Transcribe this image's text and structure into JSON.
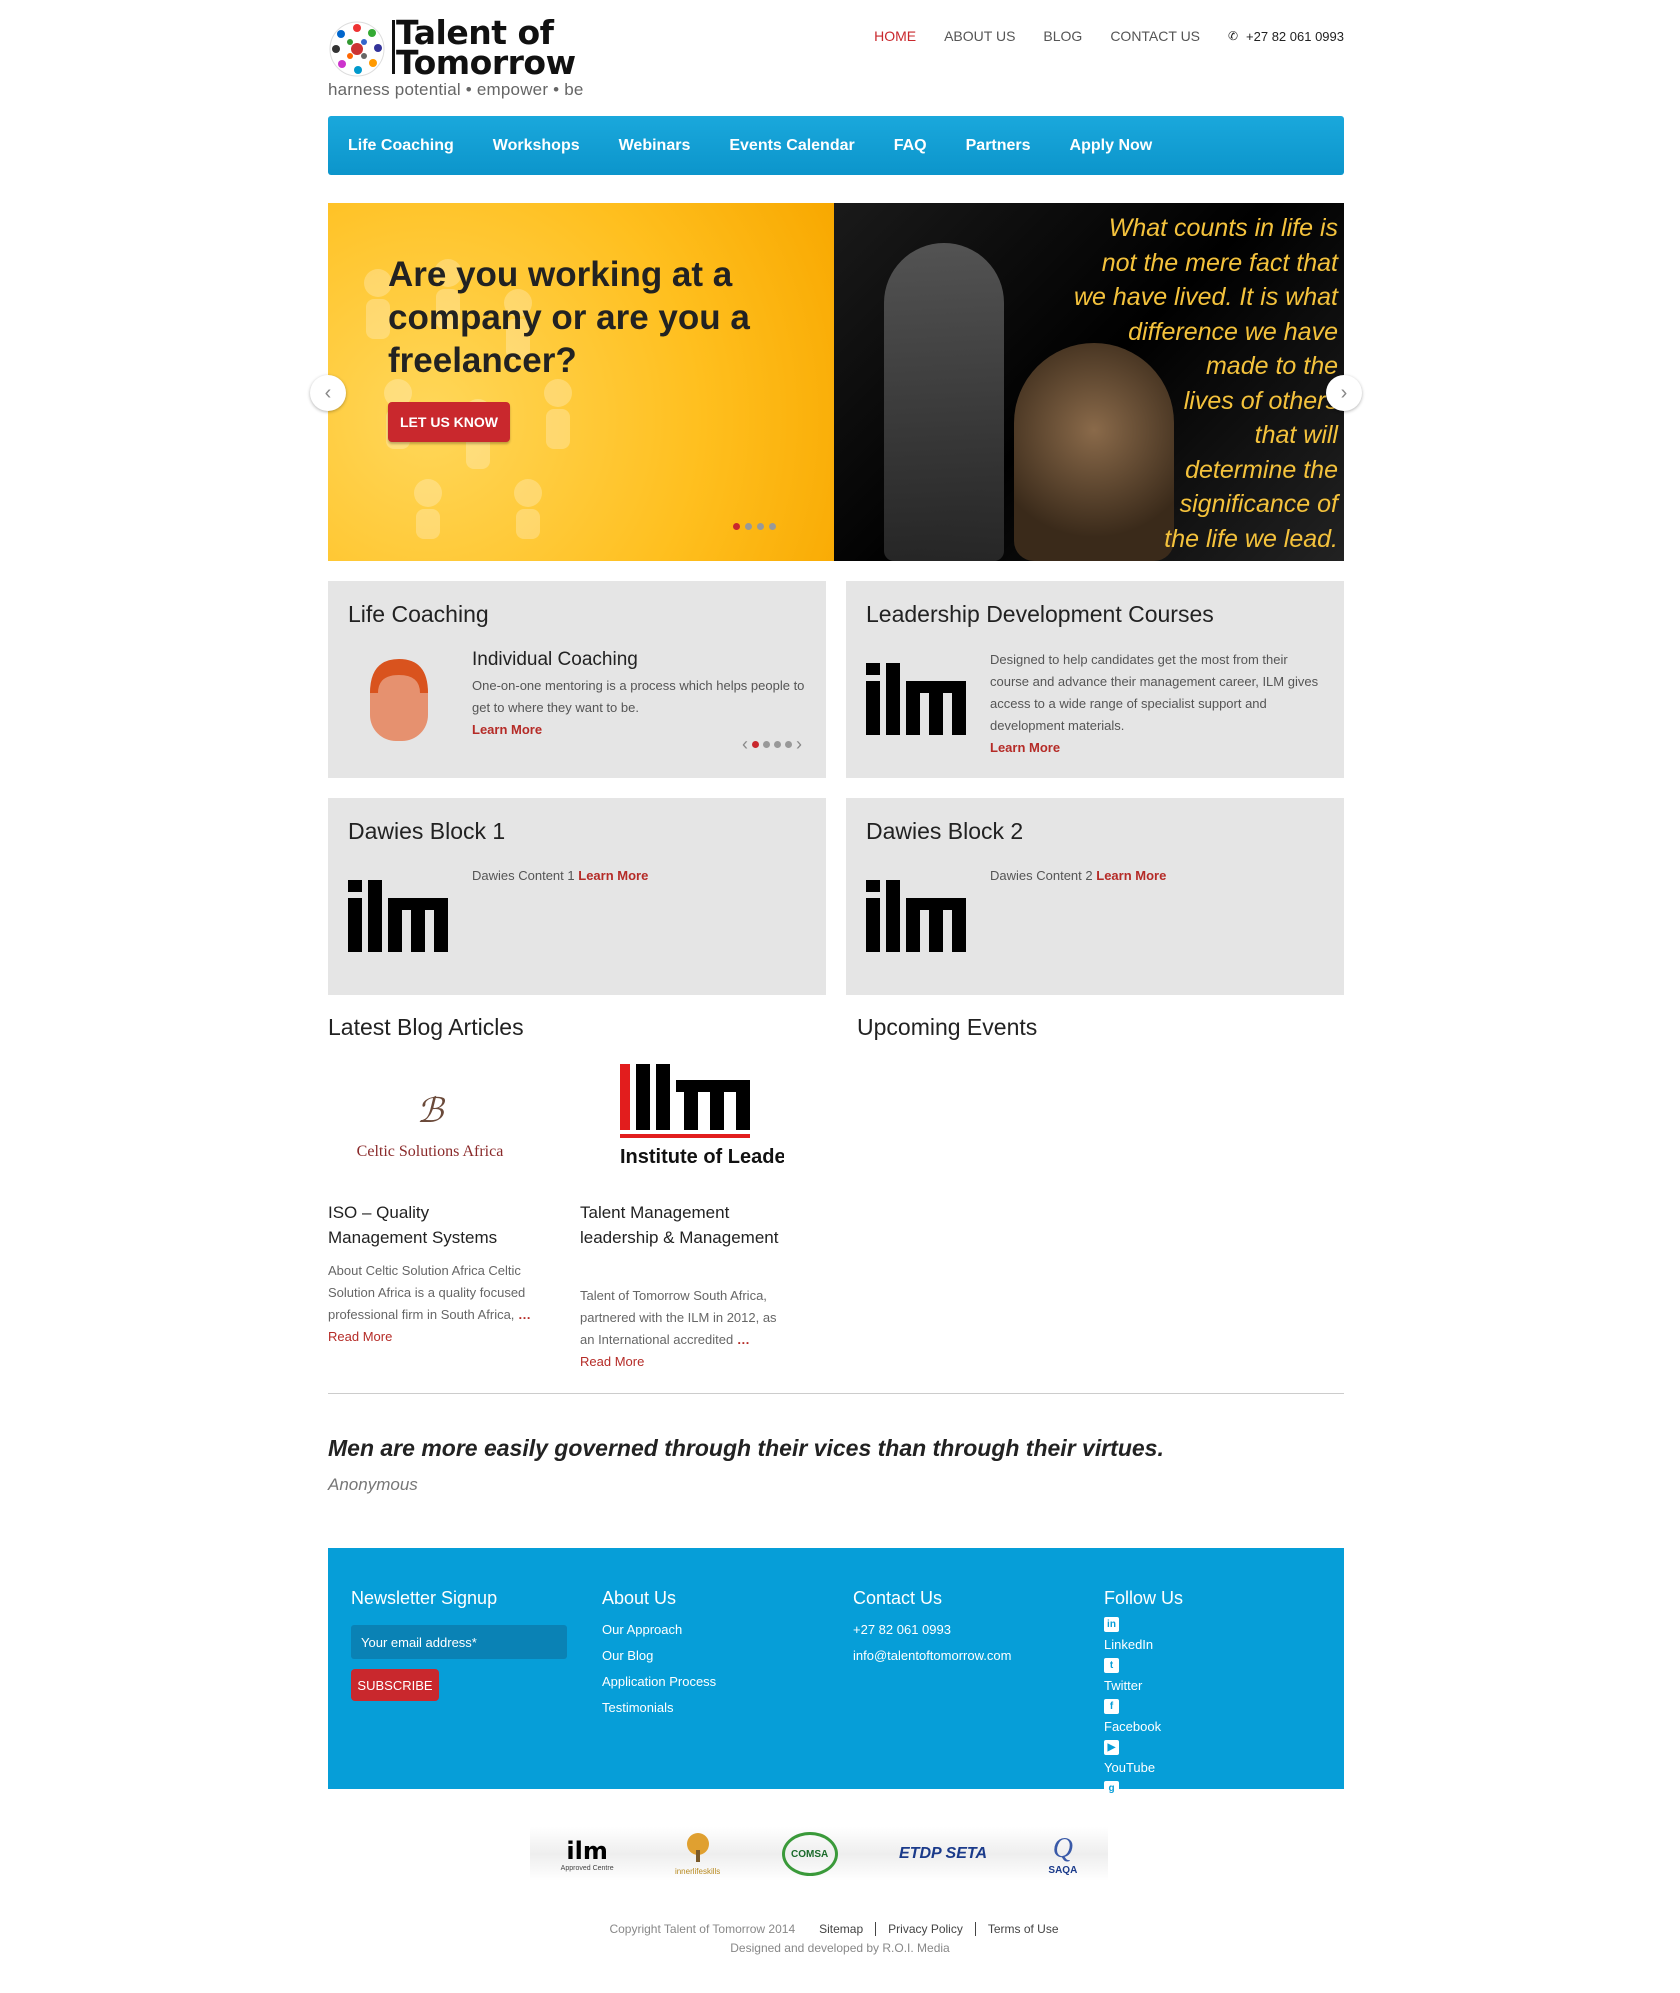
{
  "header": {
    "logo_line1": "Talent of",
    "logo_line2": "Tomorrow",
    "tagline": "harness potential • empower • be",
    "nav": [
      {
        "label": "HOME"
      },
      {
        "label": "ABOUT US"
      },
      {
        "label": "BLOG"
      },
      {
        "label": "CONTACT US"
      }
    ],
    "phone": "+27 82 061 0993"
  },
  "mainnav": [
    "Life Coaching",
    "Workshops",
    "Webinars",
    "Events Calendar",
    "FAQ",
    "Partners",
    "Apply Now"
  ],
  "hero": {
    "title": "Are you working at a company or are you a freelancer?",
    "button": "LET US KNOW",
    "quote_lines": [
      "What counts in life is",
      "not the mere fact that",
      "we have lived. It is what",
      "difference we have",
      "made to the",
      "lives of others",
      "that will",
      "determine the",
      "significance of",
      "the life we lead."
    ]
  },
  "boxes": {
    "life": {
      "title": "Life Coaching",
      "subtitle": "Individual Coaching",
      "text": "One-on-one mentoring is a process which helps people to get to where they want to be.",
      "link": "Learn More"
    },
    "leadership": {
      "title": "Leadership Development Courses",
      "text": "Designed to help candidates get the most from their course and advance their management career, ILM gives access to a wide range of specialist support and development materials.",
      "link": "Learn More"
    },
    "dawies1": {
      "title": "Dawies Block 1",
      "text": "Dawies Content 1",
      "link": "Learn More"
    },
    "dawies2": {
      "title": "Dawies Block 2",
      "text": "Dawies Content 2",
      "link": "Learn More"
    }
  },
  "blog": {
    "title": "Latest Blog Articles",
    "articles": [
      {
        "logo_text": "Celtic Solutions Africa",
        "title": "ISO – Quality Management Systems",
        "excerpt": "About Celtic Solution Africa Celtic Solution Africa is a quality focused professional firm in South Africa,",
        "ellipsis": "…",
        "read": "Read More"
      },
      {
        "logo_text": "Institute of Leadership &",
        "title": "Talent Management leadership & Management",
        "excerpt": "Talent of Tomorrow South Africa, partnered with the ILM in 2012, as an International accredited",
        "ellipsis": "…",
        "read": "Read More"
      }
    ]
  },
  "events": {
    "title": "Upcoming Events"
  },
  "quote": {
    "text": "Men are more easily governed through their vices than through their virtues.",
    "author": "Anonymous"
  },
  "footer": {
    "newsletter": {
      "title": "Newsletter Signup",
      "placeholder": "Your email address*",
      "button": "SUBSCRIBE"
    },
    "about": {
      "title": "About Us",
      "links": [
        "Our Approach",
        "Our Blog",
        "Application Process",
        "Testimonials"
      ]
    },
    "contact": {
      "title": "Contact Us",
      "phone": "+27 82 061 0993",
      "email": "info@talentoftomorrow.com"
    },
    "follow": {
      "title": "Follow Us",
      "links": [
        "LinkedIn",
        "Twitter",
        "Facebook",
        "YouTube",
        "Google+"
      ]
    }
  },
  "partners": [
    "ilm",
    "innerlifeskills",
    "COMSA",
    "ETDP SETA",
    "SAQA"
  ],
  "partner_labels": {
    "ilm_sub": "Approved Centre"
  },
  "bottom": {
    "copyright": "Copyright Talent of Tomorrow 2014",
    "links": [
      "Sitemap",
      "Privacy Policy",
      "Terms of Use"
    ],
    "designed": "Designed and developed by R.O.I. Media"
  },
  "colors": {
    "accent_red": "#c9282d",
    "nav_blue": "#0c95cb",
    "footer_blue": "#069ed8",
    "quote_gold": "#f4c23c"
  }
}
